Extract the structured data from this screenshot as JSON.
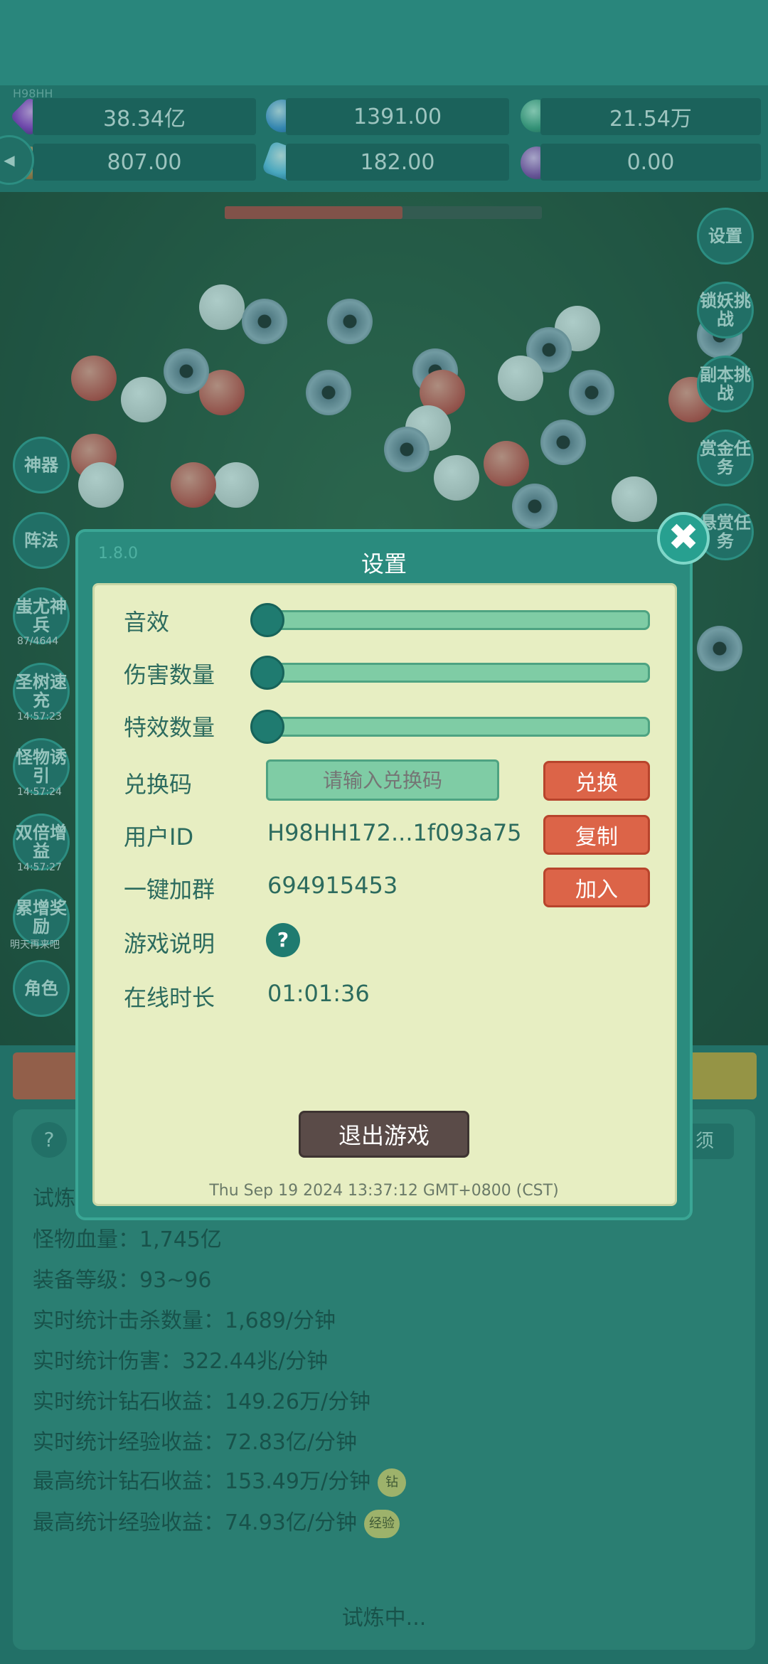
{
  "top": {
    "tiny_label": "H98HH"
  },
  "resources": [
    {
      "icon": "purple-gem-icon",
      "value": "38.34亿"
    },
    {
      "icon": "blue-orb-icon",
      "value": "1391.00"
    },
    {
      "icon": "teal-orb-icon",
      "value": "21.54万"
    },
    {
      "icon": "orange-shell-icon",
      "value": "807.00"
    },
    {
      "icon": "crystal-icon",
      "value": "182.00"
    },
    {
      "icon": "purple-pot-icon",
      "value": "0.00"
    }
  ],
  "boss_hp_fraction": 0.56,
  "left_menu": [
    {
      "label": "神器",
      "sub": ""
    },
    {
      "label": "阵法",
      "sub": ""
    },
    {
      "label": "蚩尤神兵",
      "sub": "87/4644"
    },
    {
      "label": "圣树速充",
      "sub": "14:57:23"
    },
    {
      "label": "怪物诱引",
      "sub": "14:57:24"
    },
    {
      "label": "双倍增益",
      "sub": "14:57:27"
    },
    {
      "label": "累增奖励",
      "sub": "明天再来吧"
    },
    {
      "label": "角色",
      "sub": ""
    }
  ],
  "right_menu": [
    {
      "label": "设置"
    },
    {
      "label": "锁妖挑战"
    },
    {
      "label": "副本挑战"
    },
    {
      "label": "赏金任务"
    },
    {
      "label": "悬赏任务"
    }
  ],
  "lower": {
    "help": "?",
    "right_button": "须",
    "stats": [
      {
        "text": "试炼",
        "tag": ""
      },
      {
        "text": "怪物血量：1,745亿",
        "tag": ""
      },
      {
        "text": "装备等级：93~96",
        "tag": ""
      },
      {
        "text": "实时统计击杀数量：1,689/分钟",
        "tag": ""
      },
      {
        "text": "实时统计伤害：322.44兆/分钟",
        "tag": ""
      },
      {
        "text": "实时统计钻石收益：149.26万/分钟",
        "tag": ""
      },
      {
        "text": "实时统计经验收益：72.83亿/分钟",
        "tag": ""
      },
      {
        "text": "最高统计钻石收益：153.49万/分钟",
        "tag": "钻"
      },
      {
        "text": "最高统计经验收益：74.93亿/分钟",
        "tag": "经验"
      }
    ],
    "status": "试炼中..."
  },
  "dialog": {
    "version": "1.8.0",
    "title": "设置",
    "close_symbol": "✖",
    "sliders": [
      {
        "label": "音效",
        "value": 0
      },
      {
        "label": "伤害数量",
        "value": 0
      },
      {
        "label": "特效数量",
        "value": 0
      }
    ],
    "redeem": {
      "label": "兑换码",
      "placeholder": "请输入兑换码",
      "button": "兑换"
    },
    "user_id": {
      "label": "用户ID",
      "value": "H98HH172...1f093a75",
      "button": "复制"
    },
    "group": {
      "label": "一键加群",
      "value": "694915453",
      "button": "加入"
    },
    "help": {
      "label": "游戏说明",
      "symbol": "?"
    },
    "online": {
      "label": "在线时长",
      "value": "01:01:36"
    },
    "exit_button": "退出游戏",
    "timestamp": "Thu Sep 19 2024 13:37:12 GMT+0800 (CST)"
  }
}
